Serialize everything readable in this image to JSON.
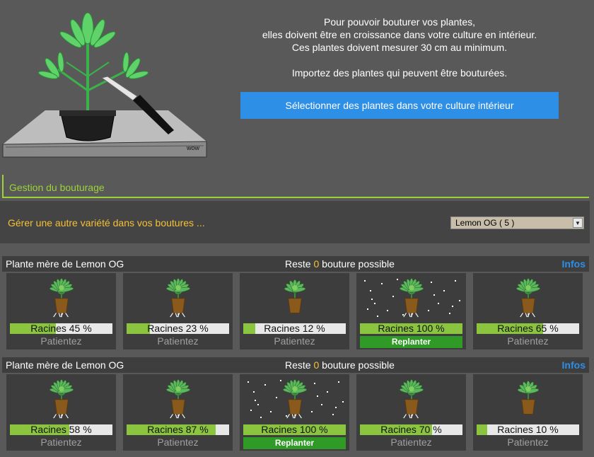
{
  "intro": {
    "line1": "Pour pouvoir bouturer vos plantes,",
    "line2": "elles doivent être en croissance dans votre culture en intérieur.",
    "line3": "Ces plantes doivent mesurer 30 cm au minimum.",
    "line4": "Importez des plantes qui peuvent être bouturées.",
    "select_button": "Sélectionner des plantes dans votre culture intérieur"
  },
  "illustration": {
    "stamp": "wow"
  },
  "section": {
    "title": "Gestion du bouturage"
  },
  "variety": {
    "label": "Gérer une autre variété dans vos boutures ...",
    "selected": "Lemon OG ( 5 )"
  },
  "colors": {
    "accent_green": "#9bd339",
    "accent_yellow": "#f4c136",
    "button_blue": "#2e8fe6",
    "progress_green": "#8bc53f",
    "replant_green": "#2f9a26"
  },
  "groups": [
    {
      "title": "Plante mère de Lemon OG",
      "remaining_prefix": "Reste",
      "remaining_count": "0",
      "remaining_suffix": "bouture possible",
      "info": "Infos",
      "cuttings": [
        {
          "label": "Racines 45 %",
          "progress": 0.45,
          "status": "Patientez",
          "ready": false
        },
        {
          "label": "Racines 23 %",
          "progress": 0.23,
          "status": "Patientez",
          "ready": false
        },
        {
          "label": "Racines 12 %",
          "progress": 0.12,
          "status": "Patientez",
          "ready": false
        },
        {
          "label": "Racines 100 %",
          "progress": 1.0,
          "status": "Replanter",
          "ready": true
        },
        {
          "label": "Racines 65 %",
          "progress": 0.65,
          "status": "Patientez",
          "ready": false
        }
      ]
    },
    {
      "title": "Plante mère de Lemon OG",
      "remaining_prefix": "Reste",
      "remaining_count": "0",
      "remaining_suffix": "bouture possible",
      "info": "Infos",
      "cuttings": [
        {
          "label": "Racines 58 %",
          "progress": 0.58,
          "status": "Patientez",
          "ready": false
        },
        {
          "label": "Racines 87 %",
          "progress": 0.87,
          "status": "Patientez",
          "ready": false
        },
        {
          "label": "Racines 100 %",
          "progress": 1.0,
          "status": "Replanter",
          "ready": true
        },
        {
          "label": "Racines 70 %",
          "progress": 0.7,
          "status": "Patientez",
          "ready": false
        },
        {
          "label": "Racines 10 %",
          "progress": 0.1,
          "status": "Patientez",
          "ready": false
        }
      ]
    }
  ]
}
